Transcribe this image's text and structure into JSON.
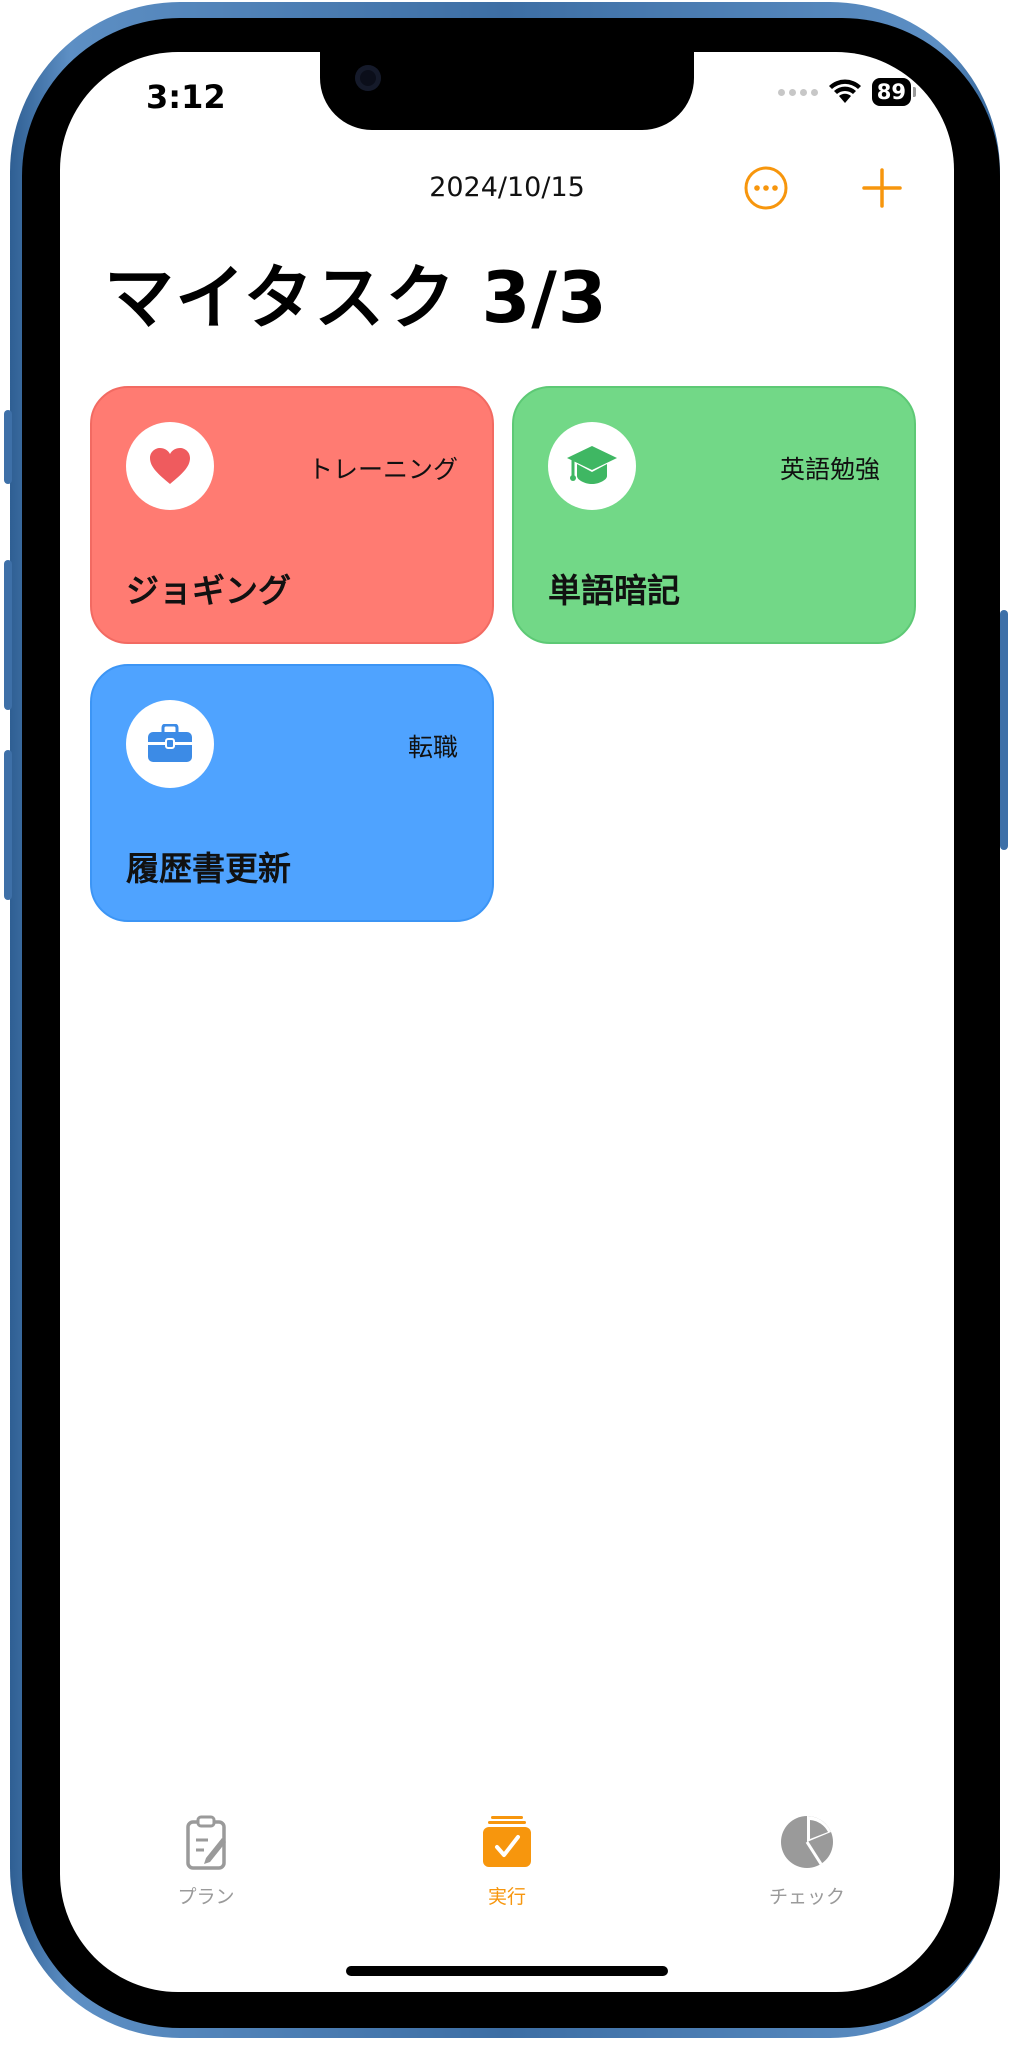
{
  "status_bar": {
    "time": "3:12",
    "battery": "89"
  },
  "header": {
    "date": "2024/10/15",
    "title": "マイタスク 3/3"
  },
  "colors": {
    "accent": "#F7960D",
    "red_card": "#FF7B72",
    "green_card": "#72D887",
    "blue_card": "#4FA3FF",
    "tab_inactive": "#9A9A9A"
  },
  "tasks": [
    {
      "category": "トレーニング",
      "name": "ジョギング",
      "icon": "heart-icon",
      "color": "#FF7B72",
      "icon_color": "#EF5B5E"
    },
    {
      "category": "英語勉強",
      "name": "単語暗記",
      "icon": "graduation-cap-icon",
      "color": "#72D887",
      "icon_color": "#3FB763"
    },
    {
      "category": "転職",
      "name": "履歴書更新",
      "icon": "briefcase-icon",
      "color": "#4FA3FF",
      "icon_color": "#3C8BE6"
    }
  ],
  "tabbar": {
    "tabs": [
      {
        "label": "プラン",
        "icon": "clipboard-edit-icon",
        "active": false
      },
      {
        "label": "実行",
        "icon": "checklist-stack-icon",
        "active": true
      },
      {
        "label": "チェック",
        "icon": "pie-chart-icon",
        "active": false
      }
    ]
  }
}
